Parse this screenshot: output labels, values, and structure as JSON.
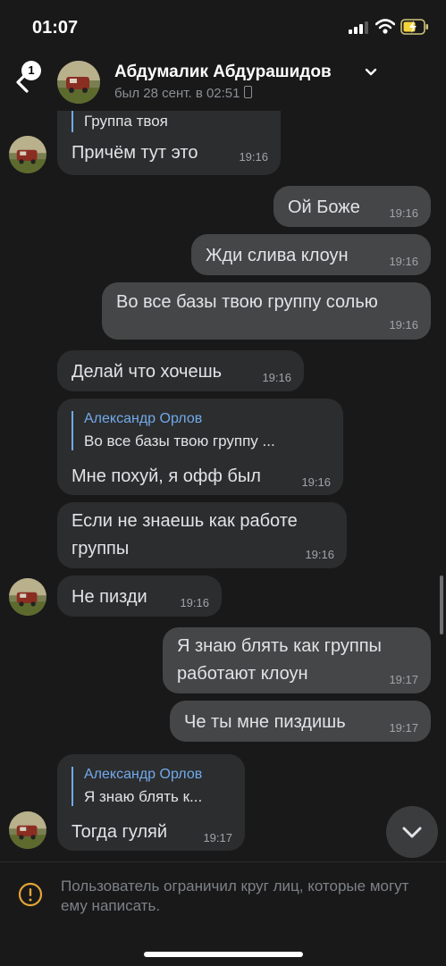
{
  "status": {
    "time": "01:07"
  },
  "header": {
    "unread_badge": "1",
    "name": "Абдумалик Абдурашидов",
    "last_seen": "был 28 сент. в 02:51"
  },
  "messages": [
    {
      "quote_tail": "Группа твоя",
      "text": "Причём тут это",
      "time": "19:16"
    },
    {
      "text": "Ой Боже",
      "time": "19:16"
    },
    {
      "text": "Жди слива клоун",
      "time": "19:16"
    },
    {
      "text": "Во все базы твою группу солью",
      "time": "19:16"
    },
    {
      "text": "Делай что хочешь",
      "time": "19:16"
    },
    {
      "quote_name": "Александр Орлов",
      "quote_text": "Во все базы твою группу ...",
      "text": "Мне похуй, я офф был",
      "time": "19:16"
    },
    {
      "lines": [
        "Если не знаешь как работе",
        "группы"
      ],
      "time": "19:16"
    },
    {
      "text": "Не пизди",
      "time": "19:16"
    },
    {
      "lines": [
        "Я знаю блять как группы",
        "работают клоун"
      ],
      "time": "19:17"
    },
    {
      "text": "Че ты мне пиздишь",
      "time": "19:17"
    },
    {
      "quote_name": "Александр Орлов",
      "quote_text": "Я знаю блять к...",
      "text": "Тогда гуляй",
      "time": "19:17"
    }
  ],
  "footer": {
    "notice": "Пользователь ограничил круг лиц, которые могут ему написать."
  },
  "icons": {
    "back": "chevron-left-icon",
    "dropdown": "chevron-down-icon",
    "scroll_down": "chevron-down-icon",
    "warning": "exclamation-circle-icon"
  },
  "colors": {
    "background": "#19191a",
    "incoming_bubble": "#2c2d2e",
    "outgoing_bubble": "#454647",
    "accent": "#71aaeb",
    "warning": "#e3a535"
  }
}
